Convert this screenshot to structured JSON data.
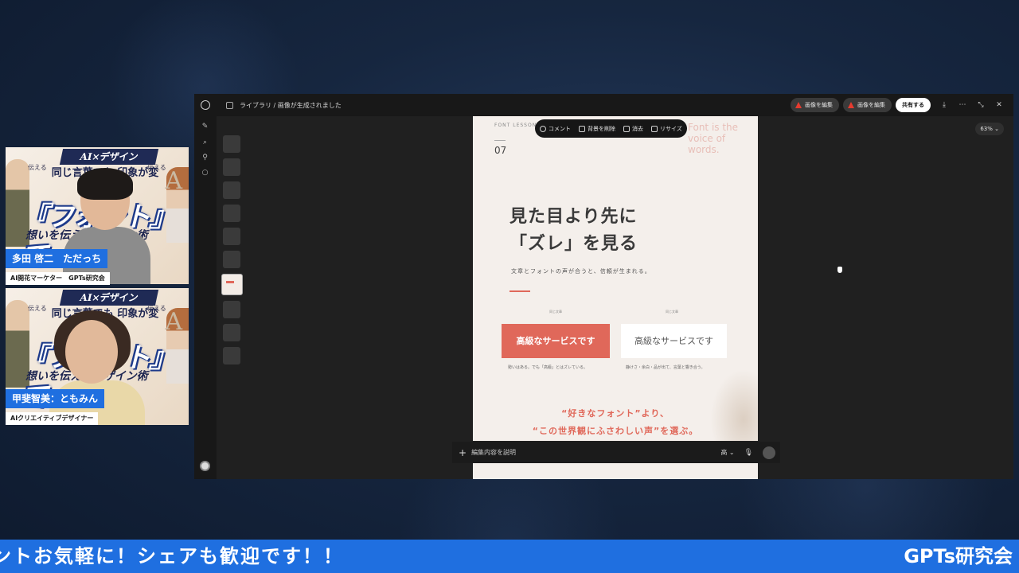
{
  "cameras": [
    {
      "name_tag": "多田 啓二　ただっち",
      "role_tag": "AI開花マーケター　GPTs研究会",
      "banner": "AI×デザイン",
      "headline": "同じ言葉でも 印象が変わる!",
      "big_word": "『フォント』で",
      "sub_line": "想いを伝えるデザイン術",
      "side_words_left": "伝える",
      "side_words_right": "伝える"
    },
    {
      "name_tag": "甲斐智美：ともみん",
      "role_tag": "AIクリエイティブデザイナー",
      "banner": "AI×デザイン",
      "headline": "同じ言葉でも 印象が変わる!",
      "big_word": "『フォント』で",
      "sub_line": "想いを伝えるデザイン術",
      "side_words_left": "伝える",
      "side_words_right": "伝える"
    }
  ],
  "app": {
    "breadcrumb": "ライブラリ / 画像が生成されました",
    "edit_buttons": [
      "画像を編集",
      "画像を編集"
    ],
    "share_label": "共有する",
    "zoom": "63%",
    "floating_toolbar": [
      "コメント",
      "背景を削除",
      "消去",
      "リサイズ"
    ],
    "prompt_placeholder": "編集内容を説明",
    "quality": "高"
  },
  "generated_image": {
    "label": "FONT LESSON",
    "lesson_number": "07",
    "voice_text": "Font is the voice of words.",
    "heading_line1": "見た目より先に",
    "heading_line2": "「ズレ」を見る",
    "subline": "文章とフォントの声が合うと、信頼が生まれる。",
    "caption_left": "同じ文章",
    "caption_right": "同じ文章",
    "box_red": "高級なサービスです",
    "box_white": "高級なサービスです",
    "note_left": "勢いはある。でも「高級」とはズレている。",
    "note_right": "静けさ・余白・品が出て、言葉と響き合う。",
    "quote_line1": "“好きなフォント”より、",
    "quote_line2": "“この世界観にふさわしい声”を選ぶ。"
  },
  "ticker": {
    "text": "ントお気軽に！シェアも歓迎です！！",
    "brand": "GPTs研究会"
  },
  "colors": {
    "accent_blue": "#1f6fe0",
    "accent_red": "#e0685a",
    "app_bg": "#202020"
  }
}
